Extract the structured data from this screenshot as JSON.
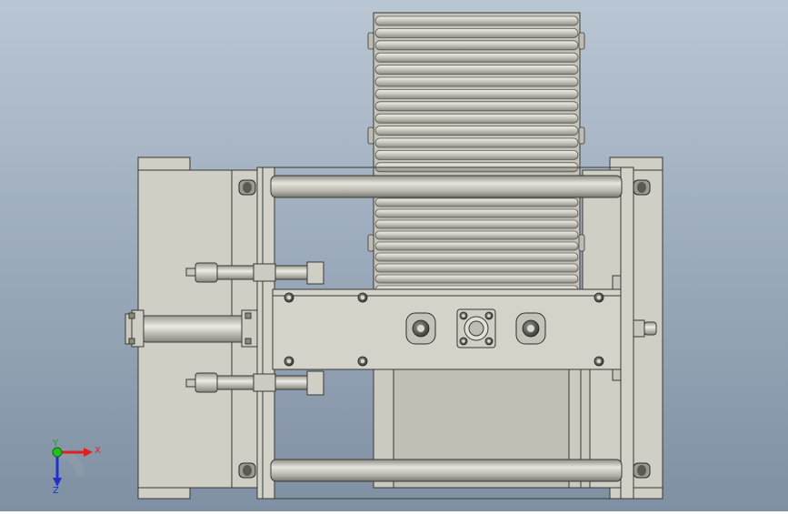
{
  "viewport": {
    "background_top": "#b9c6d4",
    "background_bottom": "#7f90a3"
  },
  "model": {
    "part_fill": "#cfcfc5",
    "part_fill_dark": "#bdbdb2",
    "edge_color": "#3a3a34",
    "tube_light": "#e8e8e0",
    "tube_mid": "#b4b4ab",
    "tube_dark": "#8a8a82"
  },
  "triad": {
    "x_label": "X",
    "y_label": "Y",
    "z_label": "Z",
    "x_color": "#e02020",
    "y_color": "#20c020",
    "z_color": "#2030d0"
  }
}
